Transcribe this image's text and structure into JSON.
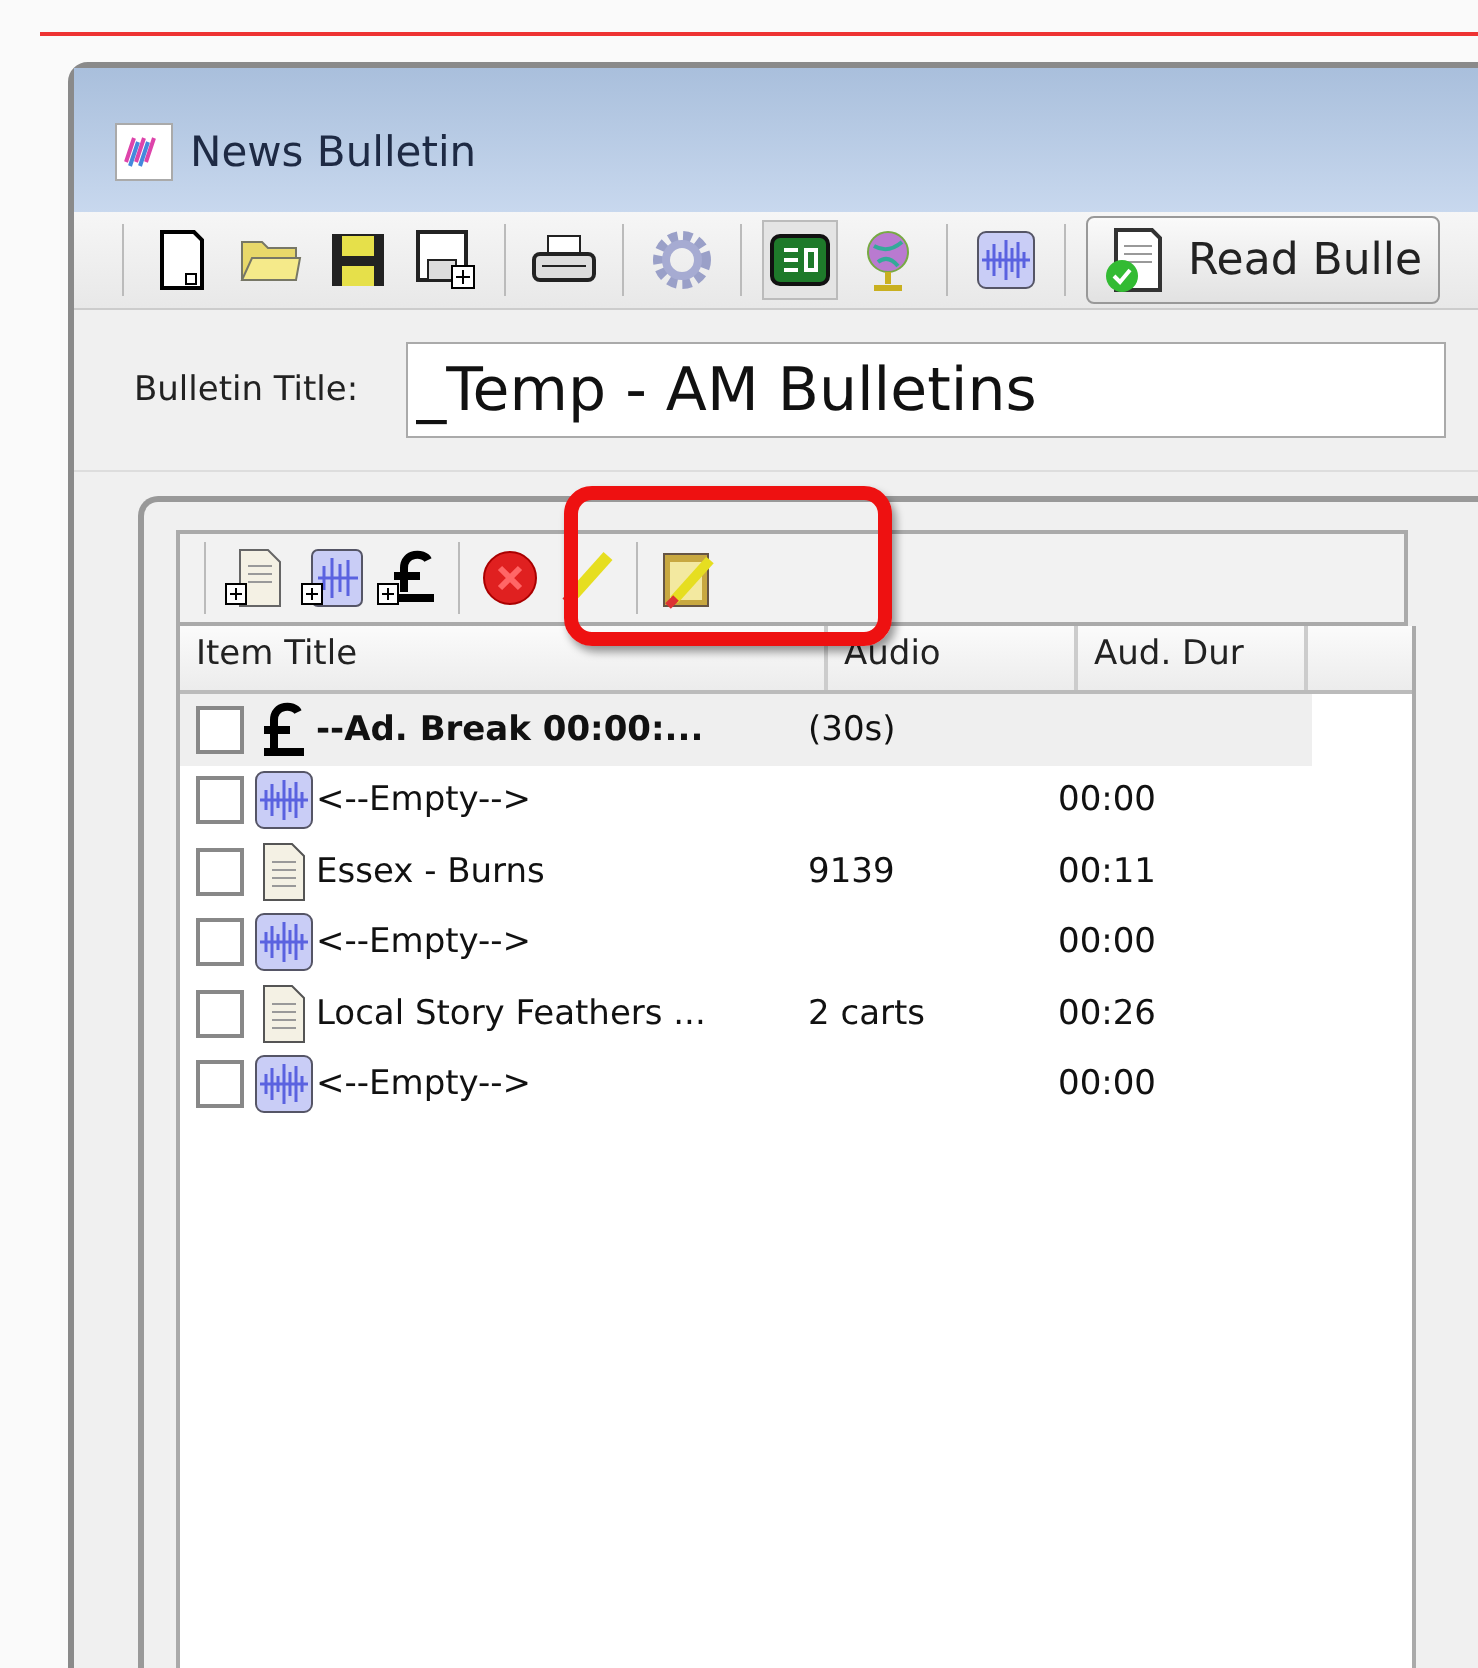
{
  "window": {
    "title": "News Bulletin"
  },
  "toolbar": [
    {
      "kind": "new"
    },
    {
      "kind": "open"
    },
    {
      "kind": "save"
    },
    {
      "kind": "saveas"
    },
    {
      "kind": "sep"
    },
    {
      "kind": "print"
    },
    {
      "kind": "sep"
    },
    {
      "kind": "gear"
    },
    {
      "kind": "sep"
    },
    {
      "kind": "view",
      "pressed": true
    },
    {
      "kind": "globe",
      "pressed": false
    },
    {
      "kind": "sep"
    },
    {
      "kind": "wave"
    },
    {
      "kind": "sep"
    }
  ],
  "read_button": {
    "label": "Read Bulle"
  },
  "bulletin_title": {
    "label": "Bulletin Title:",
    "value": "_Temp - AM Bulletins"
  },
  "item_toolbar": [
    {
      "kind": "addstory"
    },
    {
      "kind": "addaudio"
    },
    {
      "kind": "addbreak"
    },
    {
      "kind": "sep"
    },
    {
      "kind": "delete"
    },
    {
      "kind": "pencil"
    },
    {
      "kind": "sep"
    },
    {
      "kind": "clipboard"
    }
  ],
  "highlight": {
    "kind": "annotation",
    "color": "#ee1111"
  },
  "table": {
    "columns": [
      "Item Title",
      "Audio",
      "Aud. Dur"
    ],
    "rows": [
      {
        "kind": "break",
        "checked": false,
        "title": "--Ad. Break 00:00:...",
        "audio": "(30s)"
      },
      {
        "kind": "audio",
        "checked": false,
        "title": "<--Empty-->",
        "dur": "00:00"
      },
      {
        "kind": "story",
        "checked": false,
        "title": "Essex - Burns",
        "audio": "9139",
        "dur": "00:11"
      },
      {
        "kind": "audio",
        "checked": false,
        "title": "<--Empty-->",
        "dur": "00:00"
      },
      {
        "kind": "story",
        "checked": false,
        "title": "Local Story Feathers ...",
        "audio": "2 carts",
        "dur": "00:26"
      },
      {
        "kind": "audio",
        "checked": false,
        "title": "<--Empty-->",
        "dur": "00:00"
      }
    ]
  }
}
